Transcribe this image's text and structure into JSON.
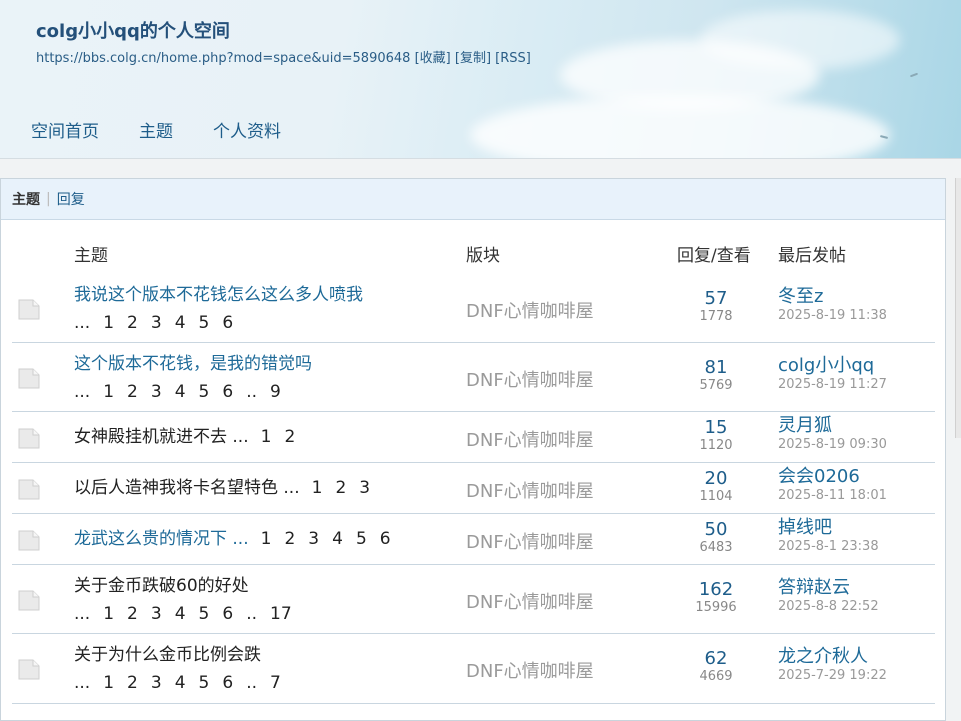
{
  "header": {
    "title": "colg小小qq的个人空间",
    "url": "https://bbs.colg.cn/home.php?mod=space&uid=5890648",
    "url_actions": [
      "[收藏]",
      "[复制]",
      "[RSS]"
    ],
    "nav": [
      "空间首页",
      "主题",
      "个人资料"
    ]
  },
  "tabs": {
    "active": "主题",
    "separator": "|",
    "other": "回复"
  },
  "columns": {
    "title": "主题",
    "forum": "版块",
    "stats": "回复/查看",
    "last": "最后发帖"
  },
  "rows": [
    {
      "title": "我说这个版本不花钱怎么这么多人喷我",
      "link": true,
      "pages": [
        "...",
        "1",
        "2",
        "3",
        "4",
        "5",
        "6"
      ],
      "forum": "DNF心情咖啡屋",
      "replies": "57",
      "views": "1778",
      "last_user": "冬至z",
      "last_time": "2025-8-19 11:38"
    },
    {
      "title": "这个版本不花钱，是我的错觉吗",
      "link": true,
      "pages": [
        "...",
        "1",
        "2",
        "3",
        "4",
        "5",
        "6",
        "..",
        "9"
      ],
      "forum": "DNF心情咖啡屋",
      "replies": "81",
      "views": "5769",
      "last_user": "colg小小qq",
      "last_time": "2025-8-19 11:27"
    },
    {
      "title": "女神殿挂机就进不去 ...",
      "link": false,
      "pages": [
        "1",
        "2"
      ],
      "forum": "DNF心情咖啡屋",
      "replies": "15",
      "views": "1120",
      "last_user": "灵月狐",
      "last_time": "2025-8-19 09:30"
    },
    {
      "title": "以后人造神我将卡名望特色 ...",
      "link": false,
      "pages": [
        "1",
        "2",
        "3"
      ],
      "forum": "DNF心情咖啡屋",
      "replies": "20",
      "views": "1104",
      "last_user": "会会0206",
      "last_time": "2025-8-11 18:01"
    },
    {
      "title": "龙武这么贵的情况下 ...",
      "link": true,
      "pages": [
        "1",
        "2",
        "3",
        "4",
        "5",
        "6"
      ],
      "forum": "DNF心情咖啡屋",
      "replies": "50",
      "views": "6483",
      "last_user": "掉线吧",
      "last_time": "2025-8-1 23:38"
    },
    {
      "title": "关于金币跌破60的好处",
      "link": false,
      "pages": [
        "...",
        "1",
        "2",
        "3",
        "4",
        "5",
        "6",
        "..",
        "17"
      ],
      "forum": "DNF心情咖啡屋",
      "replies": "162",
      "views": "15996",
      "last_user": "答辩赵云",
      "last_time": "2025-8-8 22:52"
    },
    {
      "title": "关于为什么金币比例会跌",
      "link": false,
      "pages": [
        "...",
        "1",
        "2",
        "3",
        "4",
        "5",
        "6",
        "..",
        "7"
      ],
      "forum": "DNF心情咖啡屋",
      "replies": "62",
      "views": "4669",
      "last_user": "龙之介秋人",
      "last_time": "2025-7-29 19:22"
    }
  ]
}
